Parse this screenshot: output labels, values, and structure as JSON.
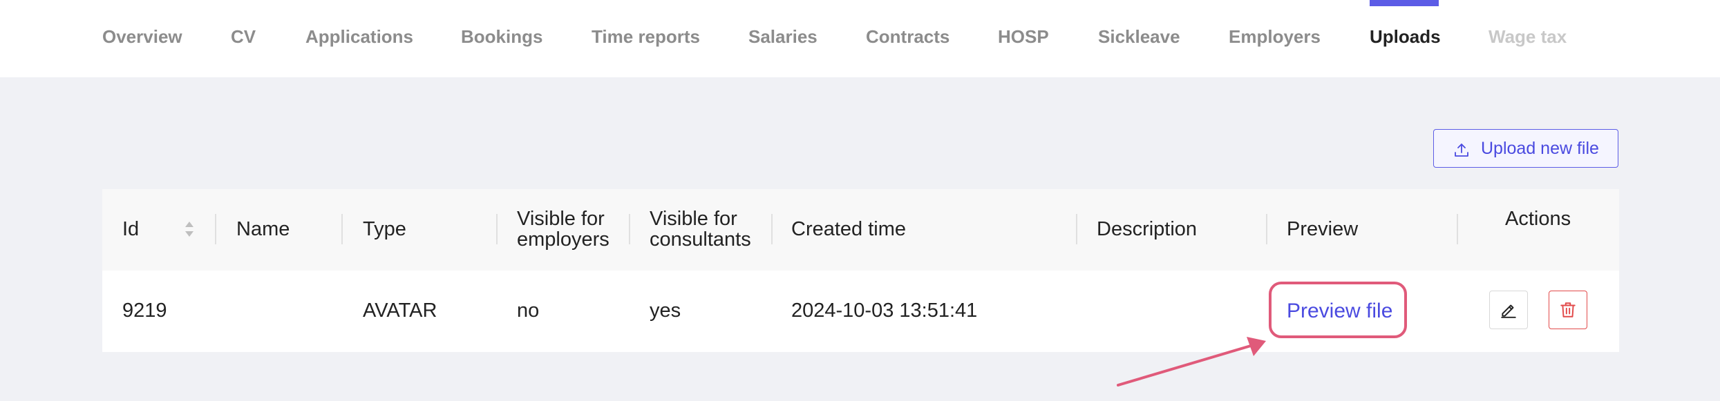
{
  "tabs": [
    {
      "label": "Overview",
      "state": "normal"
    },
    {
      "label": "CV",
      "state": "normal"
    },
    {
      "label": "Applications",
      "state": "normal"
    },
    {
      "label": "Bookings",
      "state": "normal"
    },
    {
      "label": "Time reports",
      "state": "normal"
    },
    {
      "label": "Salaries",
      "state": "normal"
    },
    {
      "label": "Contracts",
      "state": "normal"
    },
    {
      "label": "HOSP",
      "state": "normal"
    },
    {
      "label": "Sickleave",
      "state": "normal"
    },
    {
      "label": "Employers",
      "state": "normal"
    },
    {
      "label": "Uploads",
      "state": "active"
    },
    {
      "label": "Wage tax",
      "state": "disabled"
    }
  ],
  "toolbar": {
    "upload_label": "Upload new file",
    "upload_icon": "upload-icon"
  },
  "table": {
    "headers": {
      "id": "Id",
      "name": "Name",
      "type": "Type",
      "visible_employers_1": "Visible for",
      "visible_employers_2": "employers",
      "visible_consultants_1": "Visible for",
      "visible_consultants_2": "consultants",
      "created": "Created time",
      "description": "Description",
      "preview": "Preview",
      "actions": "Actions"
    },
    "rows": [
      {
        "id": "9219",
        "name": "",
        "type": "AVATAR",
        "visible_for_employers": "no",
        "visible_for_consultants": "yes",
        "created_time": "2024-10-03 13:51:41",
        "description": "",
        "preview_label": "Preview file"
      }
    ]
  },
  "colors": {
    "accent": "#5c5ce6",
    "highlight": "#e05a7a",
    "danger": "#e24a4a"
  }
}
